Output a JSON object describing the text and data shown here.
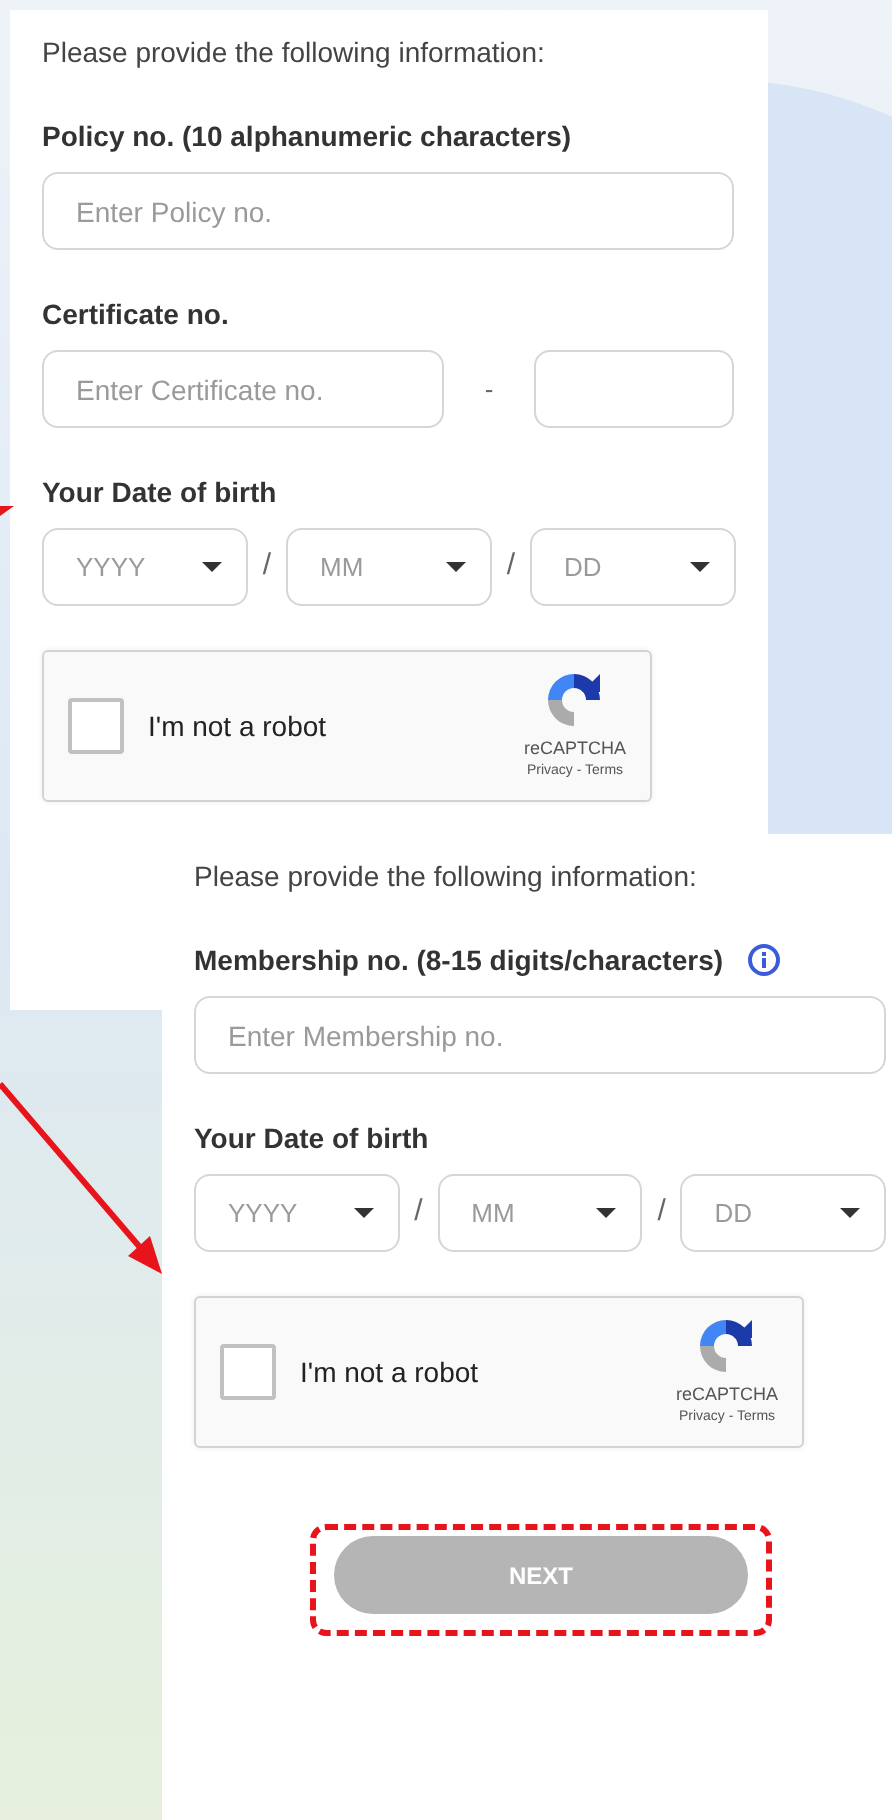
{
  "forms": [
    {
      "intro": "Please provide the following information:",
      "fields": [
        {
          "kind": "text",
          "label": "Policy no. (10 alphanumeric characters)",
          "info": false,
          "placeholder": "Enter Policy no."
        },
        {
          "kind": "split",
          "label": "Certificate no.",
          "placeholder": "Enter Certificate no.",
          "separator": "-"
        },
        {
          "kind": "date",
          "label": "Your Date of birth",
          "parts": [
            {
              "placeholder": "YYYY"
            },
            {
              "placeholder": "MM"
            },
            {
              "placeholder": "DD"
            }
          ],
          "separators": [
            "/",
            "/"
          ]
        }
      ],
      "captcha": {
        "label": "I'm not a robot",
        "checked": false,
        "brand": "reCAPTCHA",
        "links": "Privacy - Terms"
      }
    },
    {
      "intro": "Please provide the following information:",
      "fields": [
        {
          "kind": "text",
          "label": "Membership no. (8-15 digits/characters)",
          "info": true,
          "placeholder": "Enter Membership no."
        },
        {
          "kind": "date",
          "label": "Your Date of birth",
          "parts": [
            {
              "placeholder": "YYYY"
            },
            {
              "placeholder": "MM"
            },
            {
              "placeholder": "DD"
            }
          ],
          "separators": [
            "/",
            "/"
          ]
        }
      ],
      "captcha": {
        "label": "I'm not a robot",
        "checked": false,
        "brand": "reCAPTCHA",
        "links": "Privacy - Terms"
      },
      "button": {
        "label": "NEXT",
        "disabled": true
      }
    }
  ]
}
